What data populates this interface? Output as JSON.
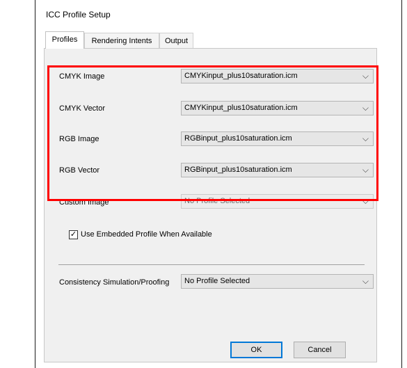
{
  "dialog": {
    "title": "ICC Profile Setup",
    "tabs": [
      {
        "label": "Profiles",
        "active": true
      },
      {
        "label": "Rendering Intents",
        "active": false
      },
      {
        "label": "Output",
        "active": false
      }
    ]
  },
  "profiles": {
    "cmyk_image": {
      "label": "CMYK Image",
      "value": "CMYKinput_plus10saturation.icm"
    },
    "cmyk_vector": {
      "label": "CMYK Vector",
      "value": "CMYKinput_plus10saturation.icm"
    },
    "rgb_image": {
      "label": "RGB Image",
      "value": "RGBinput_plus10saturation.icm"
    },
    "rgb_vector": {
      "label": "RGB Vector",
      "value": "RGBinput_plus10saturation.icm"
    },
    "custom_image": {
      "label": "Custom Image",
      "value": "No Profile Selected"
    }
  },
  "embedded": {
    "label": "Use Embedded Profile When Available",
    "checked": true,
    "check_glyph": "✓"
  },
  "consistency": {
    "label": "Consistency Simulation/Proofing",
    "value": "No Profile Selected"
  },
  "buttons": {
    "ok": "OK",
    "cancel": "Cancel"
  },
  "icons": {
    "dropdown": "chevron-down-icon",
    "chevron_glyph": "⌵"
  },
  "colors": {
    "highlight": "#ff0000",
    "default_button_border": "#0078d7"
  }
}
